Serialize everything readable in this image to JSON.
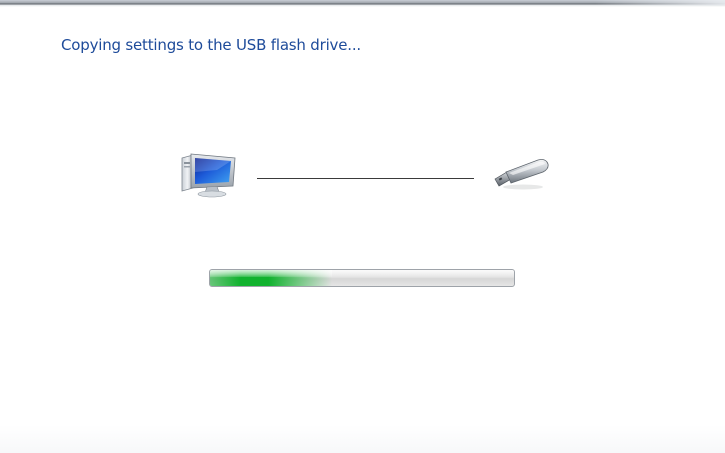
{
  "wizard": {
    "title": "Copying settings to the USB flash drive...",
    "source_icon": "computer-icon",
    "destination_icon": "usb-flash-drive-icon",
    "progress_fraction": 0.4,
    "colors": {
      "title": "#1e4b9a",
      "progress_fill": "#06b025"
    }
  }
}
